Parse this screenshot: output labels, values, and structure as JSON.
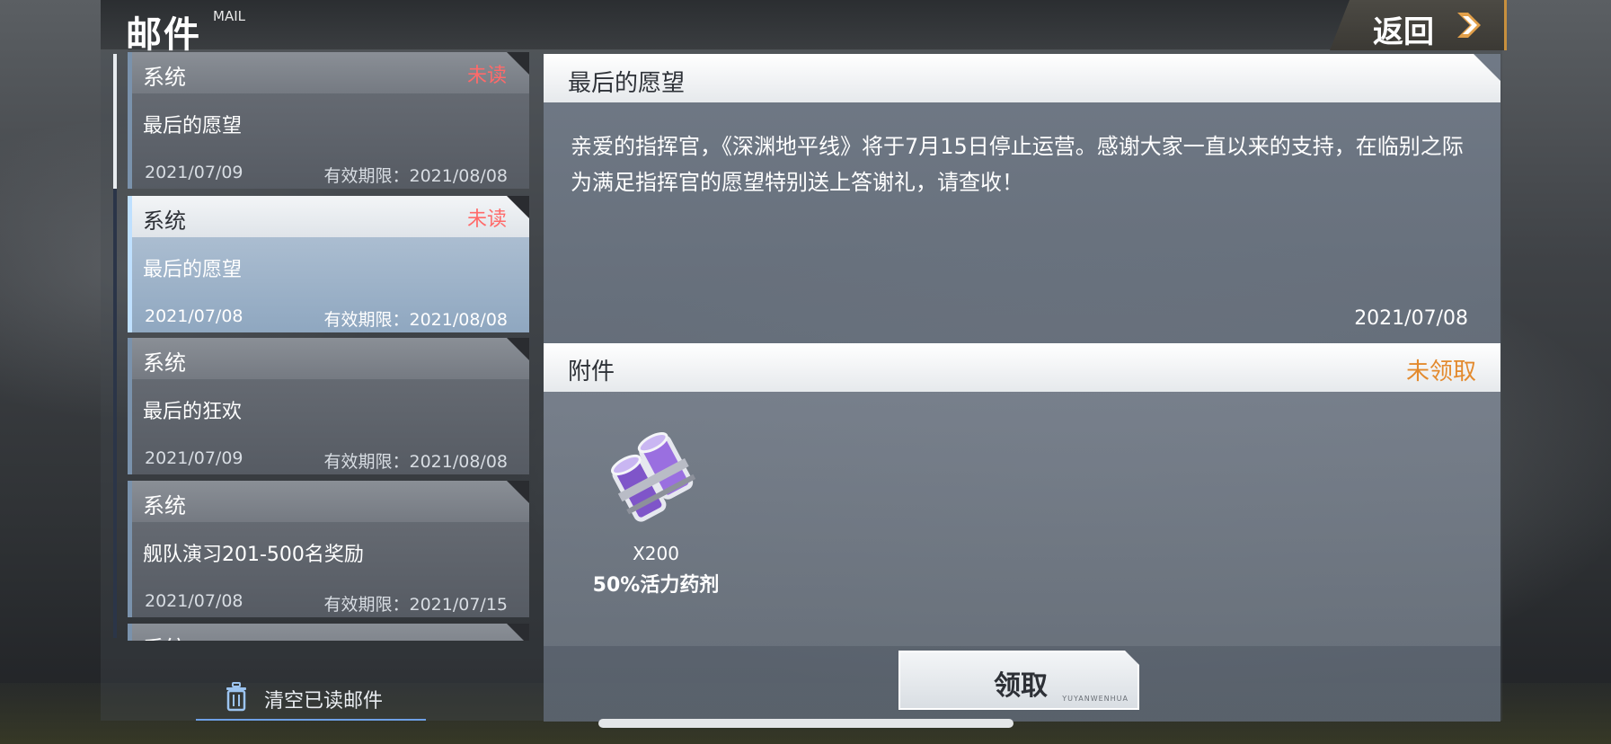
{
  "header": {
    "title": "邮件",
    "subtitle": "MAIL",
    "back_label": "返回"
  },
  "mails": [
    {
      "type": "系统",
      "status": "未读",
      "subject": "最后的愿望",
      "date": "2021/07/09",
      "expiry": "有效期限：2021/08/08",
      "selected": false
    },
    {
      "type": "系统",
      "status": "未读",
      "subject": "最后的愿望",
      "date": "2021/07/08",
      "expiry": "有效期限：2021/08/08",
      "selected": true
    },
    {
      "type": "系统",
      "status": "",
      "subject": "最后的狂欢",
      "date": "2021/07/09",
      "expiry": "有效期限：2021/08/08",
      "selected": false
    },
    {
      "type": "系统",
      "status": "",
      "subject": "舰队演习201-500名奖励",
      "date": "2021/07/08",
      "expiry": "有效期限：2021/07/15",
      "selected": false
    },
    {
      "type": "系统",
      "status": "",
      "subject": "",
      "date": "",
      "expiry": "",
      "selected": false
    }
  ],
  "clear_read_label": "清空已读邮件",
  "detail": {
    "title": "最后的愿望",
    "body": "亲爱的指挥官，《深渊地平线》将于7月15日停止运营。感谢大家一直以来的支持，在临别之际为满足指挥官的愿望特别送上答谢礼，请查收！",
    "date": "2021/07/08",
    "attachment_label": "附件",
    "attachment_status": "未领取",
    "item": {
      "quantity": "X200",
      "name": "50%活力药剂",
      "icon": "energy-potion-icon"
    },
    "claim_label": "领取",
    "claim_tag": "YUYANWENHUA"
  },
  "colors": {
    "unread": "#ff6a6a",
    "unclaimed": "#e38a2e",
    "accent": "#c8903e"
  }
}
